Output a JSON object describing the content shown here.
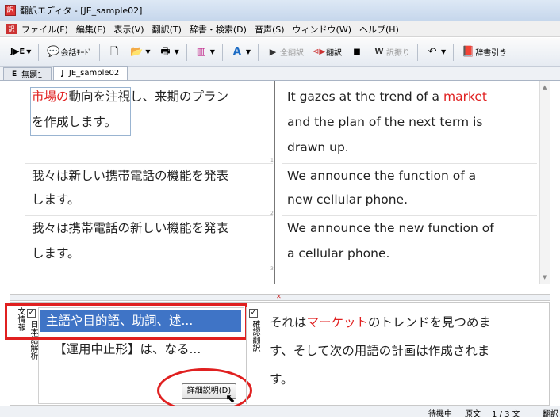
{
  "window": {
    "title": "翻訳エディタ - [JE_sample02]",
    "app_icon": "translate-app-icon"
  },
  "menubar": [
    "ファイル(F)",
    "編集(E)",
    "表示(V)",
    "翻訳(T)",
    "辞書・検索(D)",
    "音声(S)",
    "ウィンドウ(W)",
    "ヘルプ(H)"
  ],
  "toolbar": {
    "direction": "J▶E",
    "conversation_mode": "会話ﾓｰﾄﾞ",
    "translate_all": "全翻訳",
    "translate": "翻訳",
    "retranslate": "訳振り",
    "dictionary": "辞書引き"
  },
  "tabs": [
    {
      "prefix": "E",
      "label": "無題1"
    },
    {
      "prefix": "J",
      "label": "JE_sample02"
    }
  ],
  "segments": [
    {
      "no": "1",
      "src_red": "市場の",
      "src_line1": "動向を注視し、来期のプラン",
      "src_line2": "を作成します。",
      "tgt_line1": "It gazes at the trend of a ",
      "tgt_red": "market",
      "tgt_line2": "and the plan of the next term is",
      "tgt_line3": "drawn up."
    },
    {
      "no": "2",
      "src_line1": "我々は新しい携帯電話の機能を発表",
      "src_line2": "します。",
      "tgt_line1": "We announce the function of a",
      "tgt_line2": "new cellular phone."
    },
    {
      "no": "3",
      "src_line1": "我々は携帯電話の新しい機能を発表",
      "src_line2": "します。",
      "tgt_line1": "We announce the new function of",
      "tgt_line2": "a cellular phone."
    }
  ],
  "lower": {
    "bunjouhou_label": "文情報",
    "analysis_label": "日本語解析",
    "analysis_items": [
      "主語や目的語、助詞、述...",
      "【運用中止形】は、なる..."
    ],
    "detail_button": "詳細説明(D)",
    "retrans_label": "確認翻訳",
    "retrans_pre": "それは",
    "retrans_red": "マーケット",
    "retrans_post": "のトレンドを見つめま",
    "retrans_line2": "す、そして次の用語の計画は作成されま",
    "retrans_line3": "す。"
  },
  "status": {
    "state": "待機中",
    "mode": "原文",
    "position": "1 / 3 文",
    "tail": "翻訳"
  },
  "colors": {
    "accent_red": "#e02020",
    "selection_blue": "#3f74c6"
  }
}
